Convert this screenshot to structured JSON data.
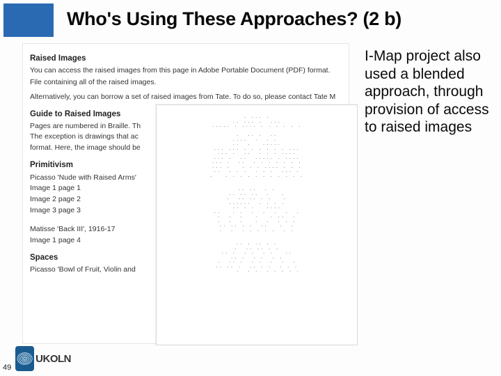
{
  "slide": {
    "title": "Who's Using These Approaches? (2 b)",
    "page_number": "49",
    "right_text": "I-Map project also used a blended approach, through provision of access to raised images",
    "logo_text": "UKOLN"
  },
  "content": {
    "h1": "Raised Images",
    "p1a": "You can access the raised images from this page in Adobe Portable Document (PDF) format.",
    "p1b": "File containing all of the raised images.",
    "p1c": "Alternatively, you can borrow a set of raised images from Tate. To do so, please contact Tate M",
    "h2": "Guide to Raised Images",
    "p2a": "Pages are numbered in Braille. Th",
    "p2b": "The exception is drawings that ac",
    "p2c": "format. Here, the image should be",
    "h3": "Primitivism",
    "p3a": "Picasso 'Nude with Raised Arms'",
    "l31": "Image 1   page 1",
    "l32": "Image 2   page 2",
    "l33": "Image 3   page 3",
    "p4a": "Matisse 'Back III', 1916-17",
    "l41": "Image 1   page 4",
    "h5": "Spaces",
    "p5a": "Picasso 'Bowl of Fruit, Violin and"
  },
  "dot_art": ". ... .\n.. ... .  ...\n..... . .... . . . . . .\n\n.  .. .  ..\n....  .  . . \n..  .   .....\n... ... . . . . . . ...\n... .  ..  . . . ....\n... .  ..  ..... . ....\n... .  ..  . . . . . . .\n... .   . . . .... . . .\n..  . . .  . . .  ... .\n.   . . . . . . . . . . .\n\n\n.. ..  . .\n.. .. ..  .   .\n.  .. .. . .   .\n......  . . . .\n.. . .   ....\n..   . .  .  .  .  .  .\n.  .  .   .   . ..  .\n.  .  .   .  .  . . .\n.. .. . .  ..   .  .\n.  .  . . . . .  . .\n\n\n.. . .. . .\n.  .. .. . .\n.. .  . .  . .   ..\n.. .  . .  . .\n.  .. .  . .  .  .  .\n.. .. .  .. . .  . . .\n      .  . .  . . . . ."
}
